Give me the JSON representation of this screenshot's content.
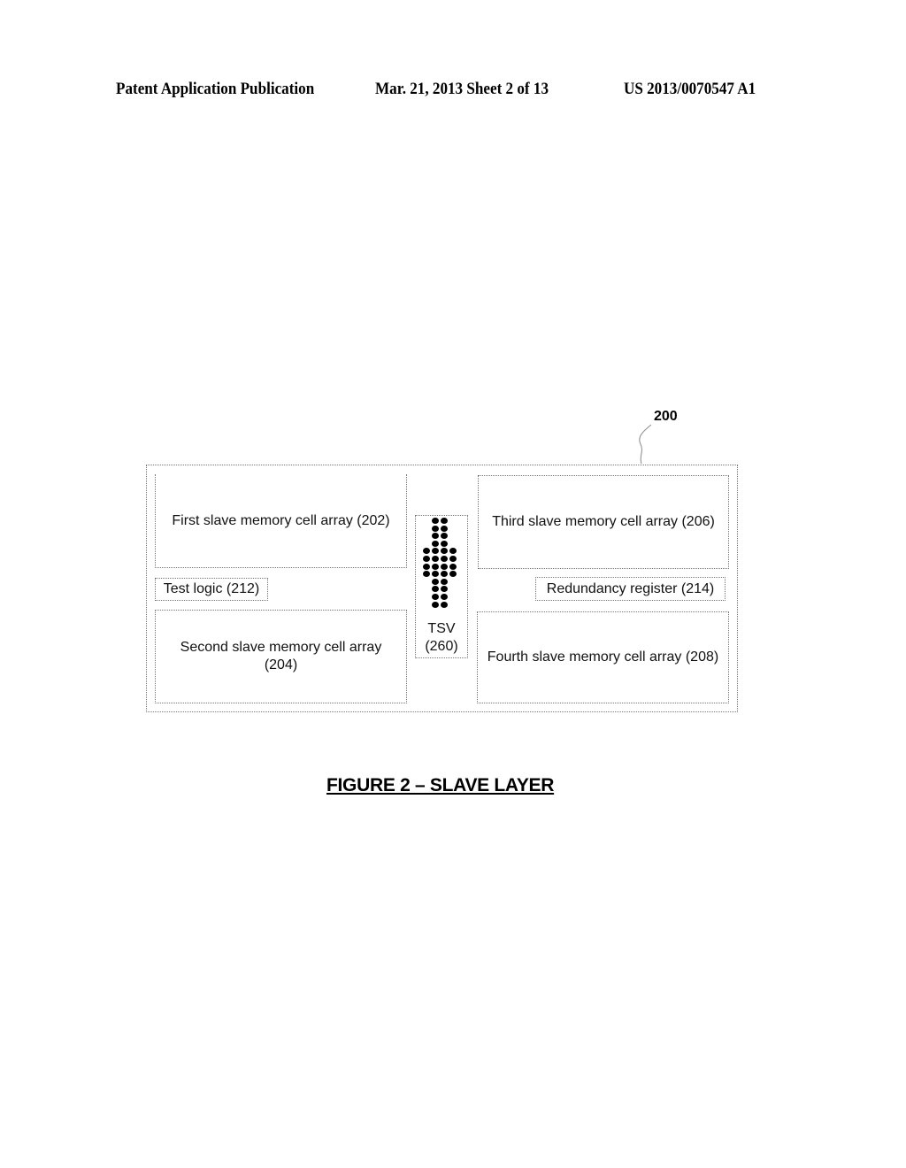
{
  "header": {
    "publication": "Patent Application Publication",
    "date_sheet": "Mar. 21, 2013  Sheet 2 of 13",
    "number": "US 2013/0070547 A1"
  },
  "figure": {
    "reference": "200",
    "caption": "FIGURE 2 – SLAVE LAYER",
    "blocks": {
      "first_array": "First slave memory cell array (202)",
      "second_array_line1": "Second slave memory cell array",
      "second_array_line2": "(204)",
      "third_array": "Third slave memory cell array (206)",
      "fourth_array": "Fourth slave memory cell array (208)",
      "test_logic": "Test logic (212)",
      "redundancy_register": "Redundancy register (214)",
      "tsv_line1": "TSV",
      "tsv_line2": "(260)"
    },
    "tsv_dot_rows": [
      2,
      2,
      2,
      2,
      4,
      4,
      4,
      4,
      2,
      2,
      2,
      2
    ]
  }
}
